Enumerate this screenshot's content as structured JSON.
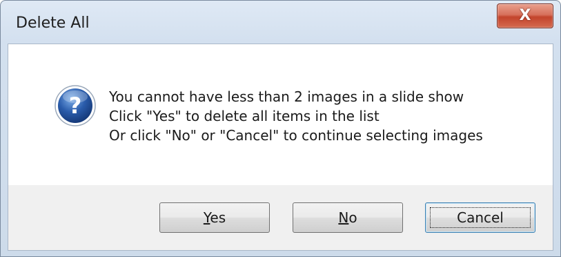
{
  "dialog": {
    "title": "Delete All",
    "close_glyph": "X"
  },
  "icon": {
    "name": "question-icon",
    "glyph": "?",
    "color": "#2a5cab"
  },
  "message": {
    "lines": [
      "You cannot have less than 2 images in a slide show",
      "Click \"Yes\" to delete all items in the list",
      "Or click \"No\" or \"Cancel\" to continue selecting images"
    ]
  },
  "buttons": {
    "yes": {
      "mnemonic": "Y",
      "rest": "es"
    },
    "no": {
      "mnemonic": "N",
      "rest": "o"
    },
    "cancel": {
      "label": "Cancel"
    }
  },
  "colors": {
    "close_button": "#c3442c",
    "button_area": "#f0f0f0",
    "default_button_border": "#3c7fb1"
  }
}
